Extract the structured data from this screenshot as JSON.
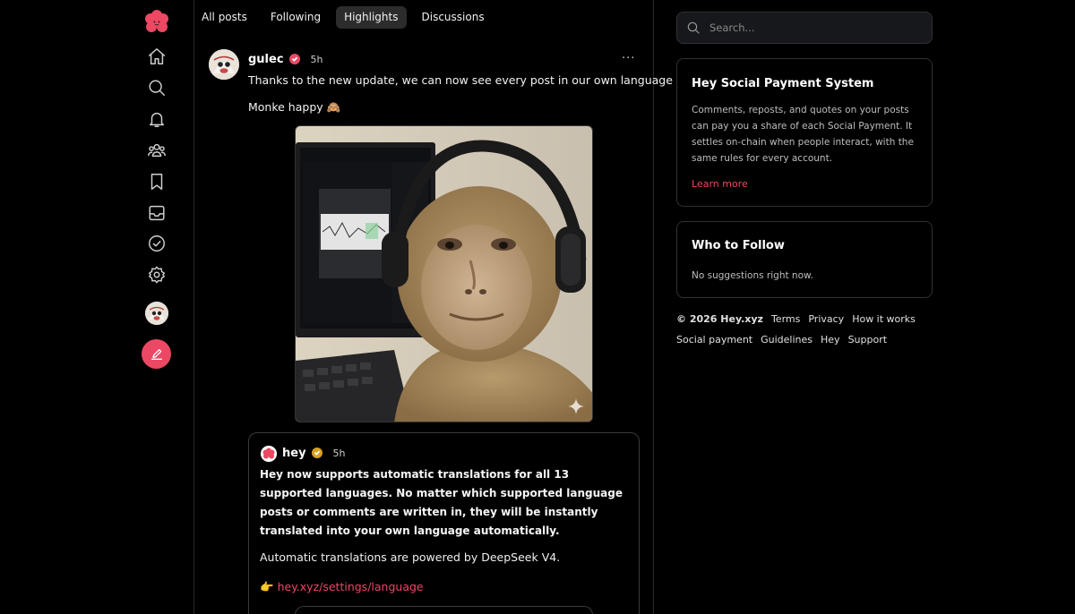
{
  "nav": {
    "tabs": [
      {
        "label": "All posts",
        "active": false
      },
      {
        "label": "Following",
        "active": false
      },
      {
        "label": "Highlights",
        "active": true
      },
      {
        "label": "Discussions",
        "active": false
      }
    ],
    "rail_icons": [
      "home-icon",
      "search-icon",
      "bell-icon",
      "groups-icon",
      "bookmark-icon",
      "inbox-icon",
      "check-circle-icon",
      "settings-icon"
    ]
  },
  "post": {
    "author": "gulec",
    "time": "5h",
    "more": "···",
    "text_line1": "Thanks to the new update, we can now see every post in our own language",
    "text_line2": "Monke happy 🙈",
    "quoted": {
      "author": "hey",
      "time": "5h",
      "bold_text": "Hey now supports automatic translations for all 13 supported languages. No matter which supported language posts or comments are written in, they will be instantly translated into your own language automatically.",
      "text": "Automatic translations are powered by DeepSeek V4.",
      "link_emoji": "👉",
      "link": "hey.xyz/settings/language"
    }
  },
  "sidebar": {
    "search_placeholder": "Search...",
    "payment_card": {
      "title": "Hey Social Payment System",
      "body": "Comments, reposts, and quotes on your posts can pay you a share of each Social Payment. It settles on-chain when people interact, with the same rules for every account.",
      "link": "Learn more"
    },
    "follow_card": {
      "title": "Who to Follow",
      "body": "No suggestions right now."
    },
    "footer_row1": [
      "© 2026 Hey.xyz",
      "Terms",
      "Privacy",
      "How it works"
    ],
    "footer_row2": [
      "Social payment",
      "Guidelines",
      "Hey",
      "Support"
    ]
  },
  "colors": {
    "accent": "#ec4863",
    "background": "#000000",
    "border": "#2f3035",
    "verified_gold": "#d9a21f"
  }
}
